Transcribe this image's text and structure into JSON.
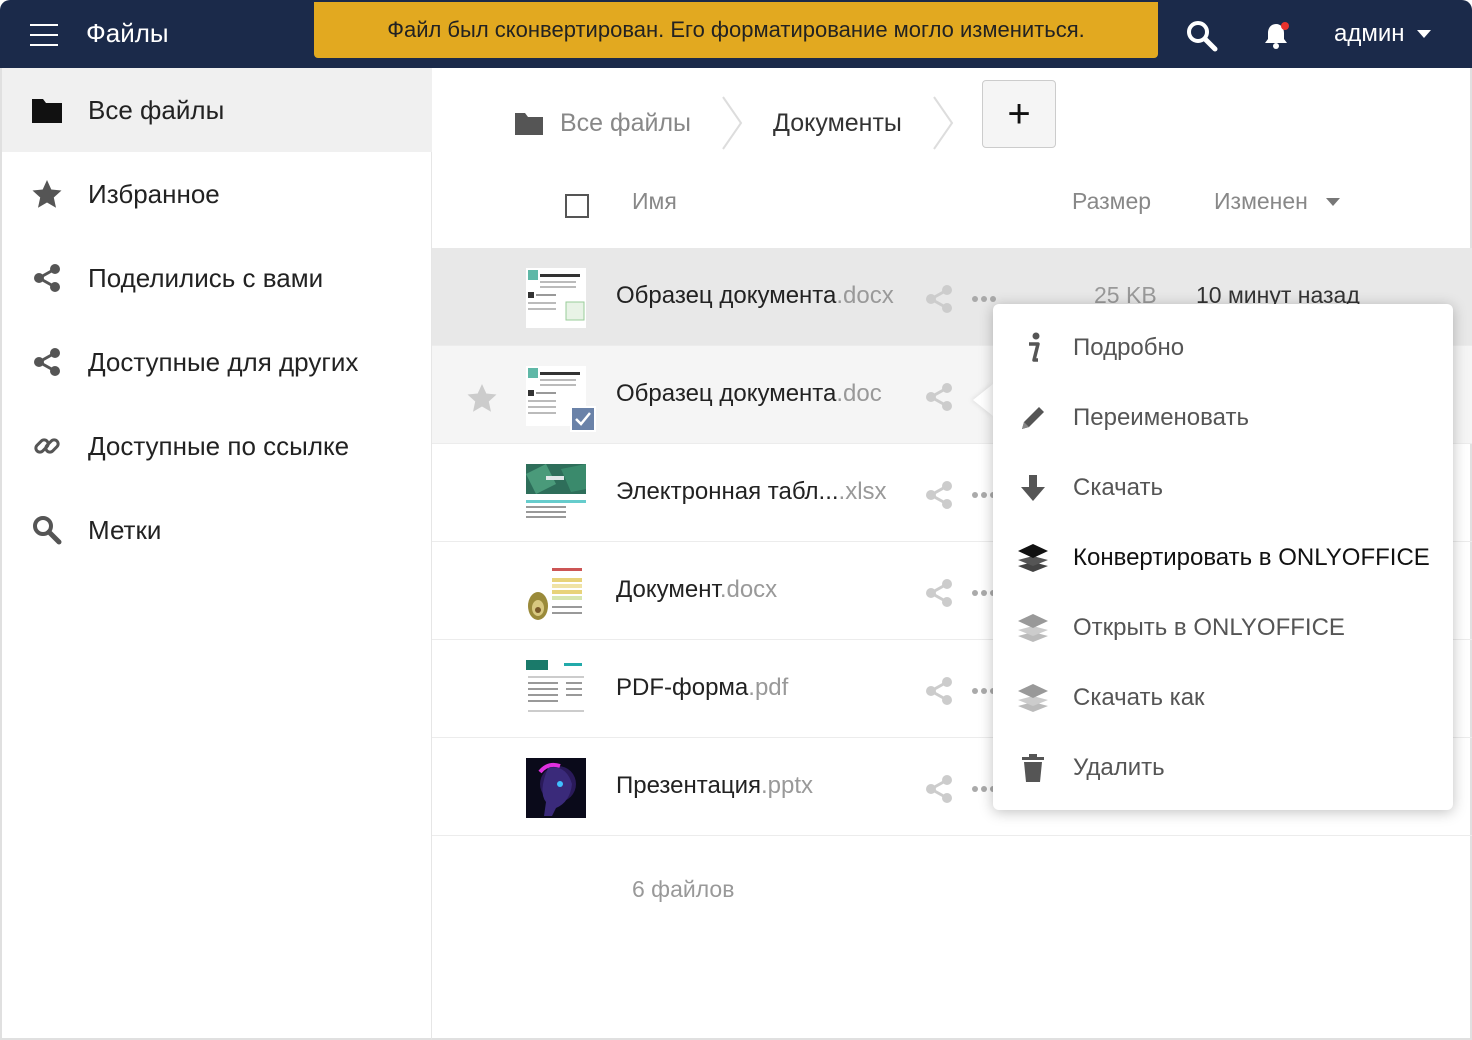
{
  "header": {
    "app_title": "Файлы",
    "toast": "Файл был сконвертирован. Его форматирование могло измениться.",
    "user": "админ"
  },
  "sidebar": {
    "items": [
      {
        "label": "Все файлы",
        "icon": "folder-icon",
        "active": true
      },
      {
        "label": "Избранное",
        "icon": "star-icon"
      },
      {
        "label": "Поделились с вами",
        "icon": "share-icon"
      },
      {
        "label": "Доступные для других",
        "icon": "share-icon"
      },
      {
        "label": "Доступные по ссылке",
        "icon": "link-icon"
      },
      {
        "label": "Метки",
        "icon": "search-icon"
      }
    ]
  },
  "breadcrumb": {
    "root": "Все файлы",
    "current": "Документы",
    "add_label": "+"
  },
  "columns": {
    "name": "Имя",
    "size": "Размер",
    "modified": "Изменен"
  },
  "files": [
    {
      "name": "Образец документа",
      "ext": ".docx",
      "size": "25 KB",
      "modified": "10 минут назад"
    },
    {
      "name": "Образец документа",
      "ext": ".doc"
    },
    {
      "name": "Электронная табл...",
      "ext": ".xlsx"
    },
    {
      "name": "Документ",
      "ext": ".docx"
    },
    {
      "name": "PDF-форма",
      "ext": ".pdf"
    },
    {
      "name": "Презентация",
      "ext": ".pptx"
    }
  ],
  "footer": {
    "count": "6 файлов"
  },
  "menu": {
    "items": [
      {
        "label": "Подробно",
        "icon": "info-icon"
      },
      {
        "label": "Переименовать",
        "icon": "pencil-icon"
      },
      {
        "label": "Скачать",
        "icon": "download-icon"
      },
      {
        "label": "Конвертировать в  ONLYOFFICE",
        "icon": "layers-icon"
      },
      {
        "label": "Открыть в  ONLYOFFICE",
        "icon": "layers-icon"
      },
      {
        "label": "Скачать как",
        "icon": "layers-icon"
      },
      {
        "label": "Удалить",
        "icon": "trash-icon"
      }
    ]
  },
  "colors": {
    "header_bg": "#1b2a4a",
    "toast_bg": "#e2a920",
    "notification_dot": "#e9322d"
  }
}
